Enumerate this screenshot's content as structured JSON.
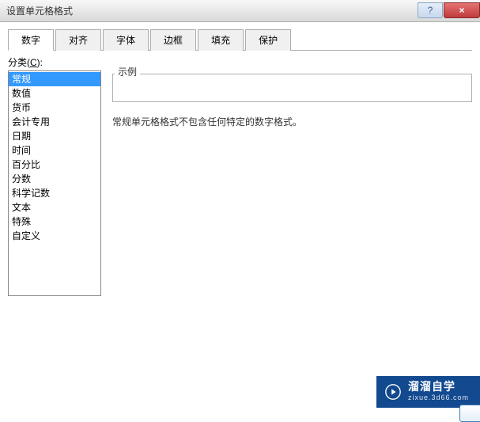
{
  "window": {
    "title": "设置单元格格式",
    "help_symbol": "?",
    "close_symbol": "×"
  },
  "tabs": [
    {
      "label": "数字",
      "active": true
    },
    {
      "label": "对齐",
      "active": false
    },
    {
      "label": "字体",
      "active": false
    },
    {
      "label": "边框",
      "active": false
    },
    {
      "label": "填充",
      "active": false
    },
    {
      "label": "保护",
      "active": false
    }
  ],
  "category": {
    "label_prefix": "分类(",
    "label_key": "C",
    "label_suffix": "):",
    "items": [
      "常规",
      "数值",
      "货币",
      "会计专用",
      "日期",
      "时间",
      "百分比",
      "分数",
      "科学记数",
      "文本",
      "特殊",
      "自定义"
    ],
    "selected_index": 0
  },
  "sample": {
    "label": "示例",
    "value": ""
  },
  "description": "常规单元格格式不包含任何特定的数字格式。",
  "watermark": {
    "main": "溜溜自学",
    "sub": "zixue.3d66.com"
  }
}
